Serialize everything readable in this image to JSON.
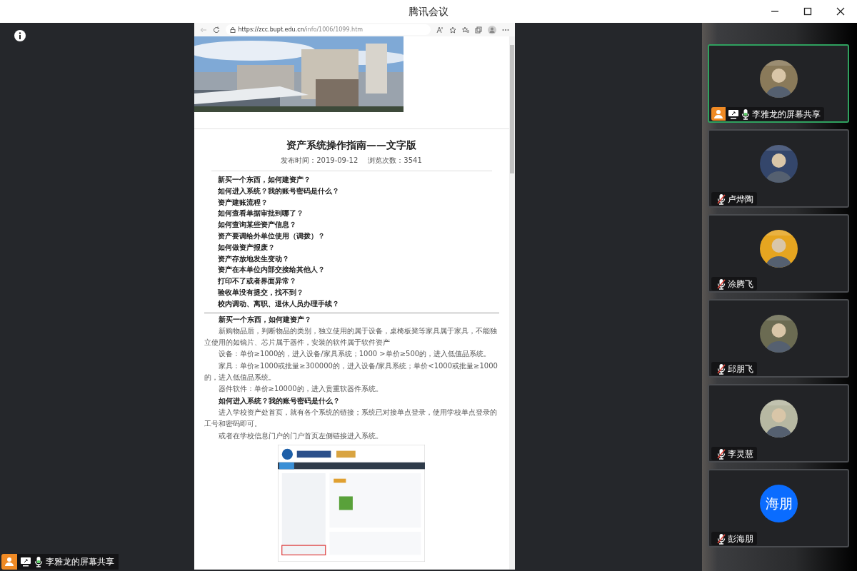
{
  "window": {
    "title": "腾讯会议"
  },
  "browser": {
    "url_host": "https://zcc.bupt.edu.cn",
    "url_path": "/info/1006/1099.htm"
  },
  "article": {
    "title": "资产系统操作指南——文字版",
    "published": "发布时间：2019-09-12",
    "views": "浏览次数：3541",
    "toc": [
      "新买一个东西，如何建资产？",
      "如何进入系统？我的账号密码是什么？",
      "资产建账流程？",
      "如何查看单据审批到哪了？",
      "如何查询某些资产信息？",
      "资产要调给外单位使用（调拨）？",
      "如何做资产报废？",
      "资产存放地发生变动？",
      "资产在本单位内部交接给其他人？",
      "打印不了或者界面异常？",
      "验收单没有提交，找不到？",
      "校内调动、离职、退休人员办理手续？"
    ],
    "body": [
      {
        "kind": "heading",
        "text": "新买一个东西，如何建资产？"
      },
      {
        "kind": "para",
        "text": "新购物品后，判断物品的类别，独立使用的属于设备，桌椅板凳等家具属于家具，不能独立使用的如镜片、芯片属于器件，安装的软件属于软件资产"
      },
      {
        "kind": "para",
        "text": "设备：单价≥1000的，进入设备/家具系统；1000 >单价≥500的，进入低值品系统。"
      },
      {
        "kind": "para",
        "text": "家具：单价≥1000或批量≥300000的，进入设备/家具系统；单价<1000或批量≥1000的，进入低值品系统。"
      },
      {
        "kind": "para",
        "text": "器件软件：单价≥10000的，进入贵重软器件系统。"
      },
      {
        "kind": "heading",
        "text": "如何进入系统？我的账号密码是什么？"
      },
      {
        "kind": "para",
        "text": "进入学校资产处首页，就有各个系统的链接；系统已对接单点登录，使用学校单点登录的工号和密码即可。"
      },
      {
        "kind": "para",
        "text": "或者在学校信息门户的门户首页左侧链接进入系统。"
      },
      {
        "kind": "picture"
      }
    ]
  },
  "share_label": "李雅龙的屏幕共享",
  "participants": [
    {
      "name": "李雅龙的屏幕共享",
      "active": true,
      "sharing": true,
      "muted": false,
      "avatar": {
        "kind": "picture"
      }
    },
    {
      "name": "卢烨陶",
      "active": false,
      "sharing": false,
      "muted": true,
      "avatar": {
        "kind": "picture"
      }
    },
    {
      "name": "涂腾飞",
      "active": false,
      "sharing": false,
      "muted": true,
      "avatar": {
        "kind": "picture"
      }
    },
    {
      "name": "邱朋飞",
      "active": false,
      "sharing": false,
      "muted": true,
      "avatar": {
        "kind": "picture"
      }
    },
    {
      "name": "李灵慧",
      "active": false,
      "sharing": false,
      "muted": true,
      "avatar": {
        "kind": "picture"
      }
    },
    {
      "name": "彭海朋",
      "active": false,
      "sharing": false,
      "muted": true,
      "avatar": {
        "kind": "initials",
        "text": "海朋"
      }
    }
  ]
}
